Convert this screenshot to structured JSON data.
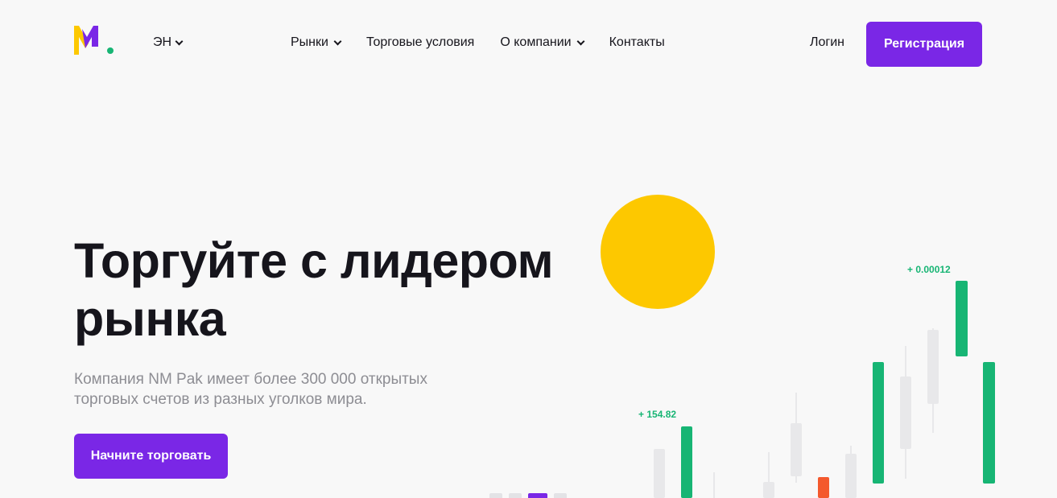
{
  "header": {
    "language": "ЭН",
    "nav": [
      {
        "label": "Рынки",
        "has_dropdown": true
      },
      {
        "label": "Торговые условия",
        "has_dropdown": false
      },
      {
        "label": "О компании",
        "has_dropdown": true
      },
      {
        "label": "Контакты",
        "has_dropdown": false
      }
    ],
    "login_label": "Логин",
    "register_label": "Регистрация"
  },
  "hero": {
    "title_line1": "Торгуйте с лидером",
    "title_line2": "рынка",
    "subtitle_line1": "Компания NM Pak имеет более 300 000 открытых",
    "subtitle_line2": "торговых счетов из разных уголков мира.",
    "cta_label": "Начните торговать"
  },
  "chart_labels": {
    "left": "+ 154.82",
    "right": "+ 0.00012"
  },
  "slider": {
    "total": 4,
    "active_index": 2
  },
  "colors": {
    "brand_purple": "#7a27e6",
    "accent_yellow": "#fdc800",
    "up_green": "#17b574",
    "down_red": "#f4592d",
    "neutral_gray": "#e8e8ea"
  }
}
